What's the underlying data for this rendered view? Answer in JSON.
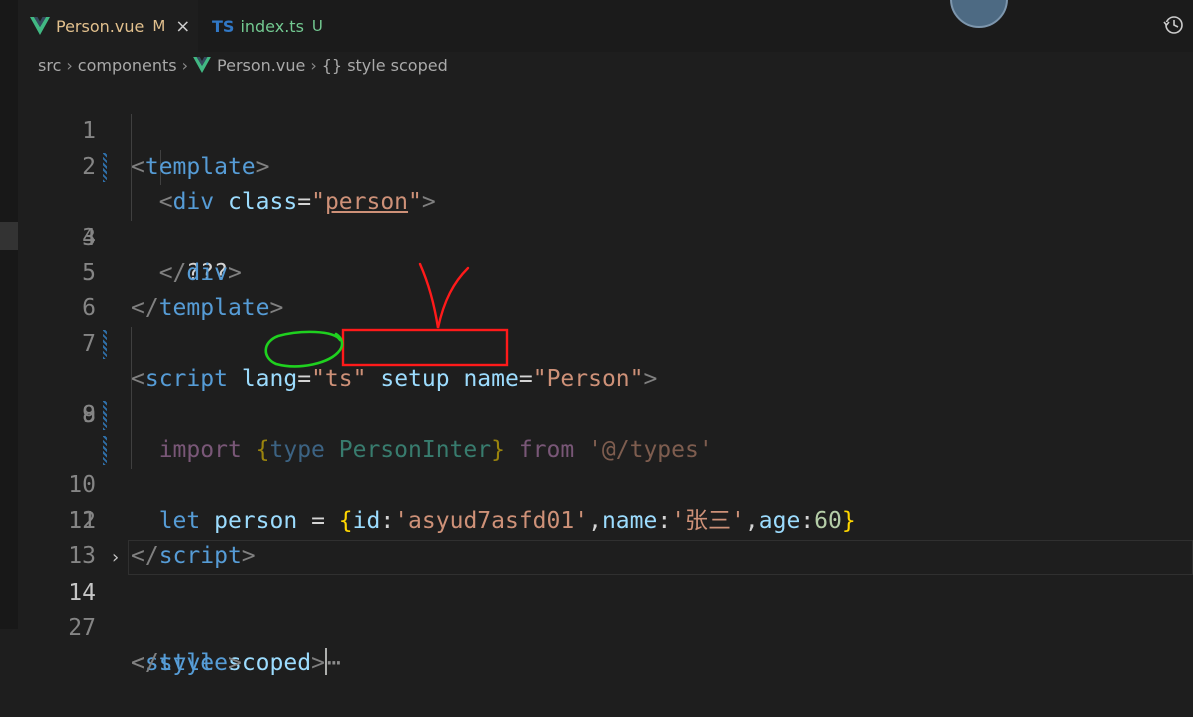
{
  "tabs": [
    {
      "name": "Person.vue",
      "badge": "M",
      "close": "×",
      "icon": "vue-icon"
    },
    {
      "name": "index.ts",
      "badge": "U",
      "prefix": "TS",
      "icon": "ts-icon"
    }
  ],
  "breadcrumb": {
    "src": "src",
    "components": "components",
    "file": "Person.vue",
    "section": "{} style scoped"
  },
  "code_lines": [
    {
      "num": "1"
    },
    {
      "num": "2"
    },
    {
      "num": "3",
      "text": "???"
    },
    {
      "num": "4"
    },
    {
      "num": "5"
    },
    {
      "num": "6"
    },
    {
      "num": "7"
    },
    {
      "num": "8"
    },
    {
      "num": "9"
    },
    {
      "num": "10"
    },
    {
      "num": "11"
    },
    {
      "num": "12"
    },
    {
      "num": "13"
    },
    {
      "num": "14"
    },
    {
      "num": "27"
    }
  ],
  "tokens": {
    "template": "template",
    "div": "div",
    "class_attr": "class",
    "class_val": "person",
    "script": "script",
    "lang": "lang",
    "lang_val": "ts",
    "setup": "setup",
    "name_attr": "name",
    "name_val": "Person",
    "import": "import",
    "type": "type",
    "person_inter": "PersonInter",
    "from": "from",
    "path": "'@/types'",
    "let": "let",
    "person_var": "person",
    "id_key": "id",
    "id_val": "'asyud7asfd01'",
    "name_key": "name",
    "name_value": "'张三'",
    "age_key": "age",
    "age_val": "60",
    "style": "style",
    "scoped": "scoped",
    "ellipsis": "⋯"
  },
  "colors": {
    "background": "#1e1e1e",
    "tag": "#569cd6",
    "attribute": "#9cdcfe",
    "string": "#ce9178",
    "keyword": "#c586c0",
    "brace": "#ffd700",
    "number": "#b5cea8",
    "annotation_red": "#ff1a1a",
    "annotation_green": "#1fd11f"
  }
}
